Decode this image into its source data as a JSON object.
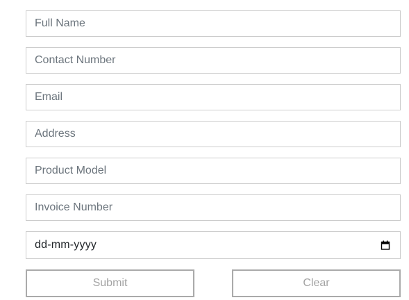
{
  "form": {
    "fields": [
      {
        "placeholder": "Full Name",
        "value": ""
      },
      {
        "placeholder": "Contact Number",
        "value": ""
      },
      {
        "placeholder": "Email",
        "value": ""
      },
      {
        "placeholder": "Address",
        "value": ""
      },
      {
        "placeholder": "Product Model",
        "value": ""
      },
      {
        "placeholder": "Invoice Number",
        "value": ""
      }
    ],
    "date": {
      "placeholder": "dd-mm-yyyy",
      "icon": "calendar-icon"
    },
    "buttons": {
      "submit_label": "Submit",
      "clear_label": "Clear"
    }
  },
  "colors": {
    "field_border": "#cccccc",
    "placeholder_text": "#6c757d",
    "button_border": "#aaaaaa",
    "button_text": "#a3a3a3"
  }
}
